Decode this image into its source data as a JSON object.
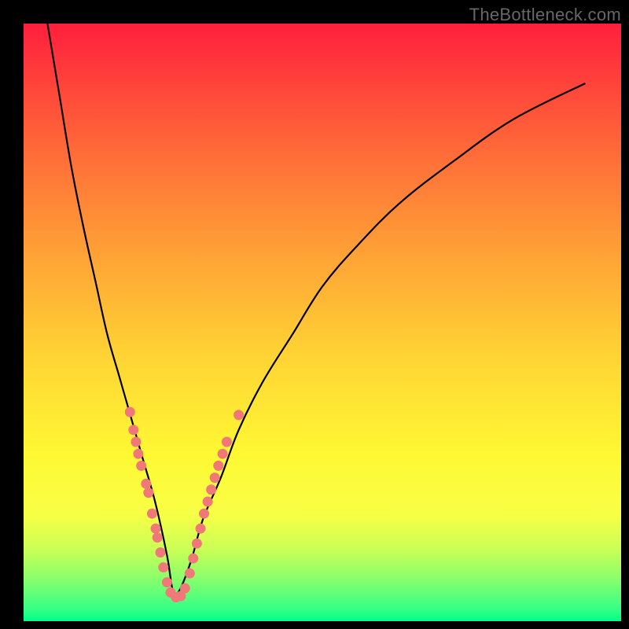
{
  "watermark": "TheBottleneck.com",
  "colors": {
    "frame": "#000000",
    "curve": "#000000",
    "dot_fill": "#f07878",
    "dot_stroke": "#d85a5a"
  },
  "chart_data": {
    "type": "line",
    "title": "",
    "xlabel": "",
    "ylabel": "",
    "xlim": [
      0,
      100
    ],
    "ylim": [
      0,
      100
    ],
    "notes": "V-shaped bottleneck curve with minimum ≈25 on x-axis; background gradient from red (high mismatch) to green (no bottleneck); scattered sample points along curve near the valley.",
    "series": [
      {
        "name": "bottleneck-curve",
        "x": [
          4,
          6,
          8,
          10,
          12,
          14,
          16,
          18,
          20,
          22,
          24,
          25,
          26,
          28,
          30,
          33,
          36,
          40,
          45,
          50,
          56,
          63,
          72,
          82,
          94
        ],
        "y": [
          100,
          88,
          76,
          66,
          57,
          48,
          41,
          34,
          27,
          20,
          11,
          5,
          5,
          10,
          17,
          24,
          32,
          40,
          48,
          56,
          63,
          70,
          77,
          84,
          90
        ]
      }
    ],
    "points": [
      {
        "x": 17.8,
        "y": 35.0
      },
      {
        "x": 18.4,
        "y": 32.0
      },
      {
        "x": 18.8,
        "y": 30.0
      },
      {
        "x": 19.2,
        "y": 28.0
      },
      {
        "x": 19.7,
        "y": 26.0
      },
      {
        "x": 20.5,
        "y": 23.0
      },
      {
        "x": 20.9,
        "y": 21.5
      },
      {
        "x": 21.5,
        "y": 18.0
      },
      {
        "x": 22.1,
        "y": 15.5
      },
      {
        "x": 22.4,
        "y": 14.0
      },
      {
        "x": 22.9,
        "y": 11.5
      },
      {
        "x": 23.4,
        "y": 9.0
      },
      {
        "x": 24.0,
        "y": 6.5
      },
      {
        "x": 24.6,
        "y": 4.8
      },
      {
        "x": 25.5,
        "y": 4.0
      },
      {
        "x": 26.3,
        "y": 4.2
      },
      {
        "x": 27.0,
        "y": 5.5
      },
      {
        "x": 27.8,
        "y": 8.0
      },
      {
        "x": 28.4,
        "y": 10.5
      },
      {
        "x": 29.0,
        "y": 13.0
      },
      {
        "x": 29.6,
        "y": 15.5
      },
      {
        "x": 30.2,
        "y": 18.0
      },
      {
        "x": 30.8,
        "y": 20.0
      },
      {
        "x": 31.4,
        "y": 22.0
      },
      {
        "x": 32.0,
        "y": 24.0
      },
      {
        "x": 32.6,
        "y": 26.0
      },
      {
        "x": 33.3,
        "y": 28.0
      },
      {
        "x": 34.0,
        "y": 30.0
      },
      {
        "x": 36.0,
        "y": 34.5
      }
    ]
  }
}
